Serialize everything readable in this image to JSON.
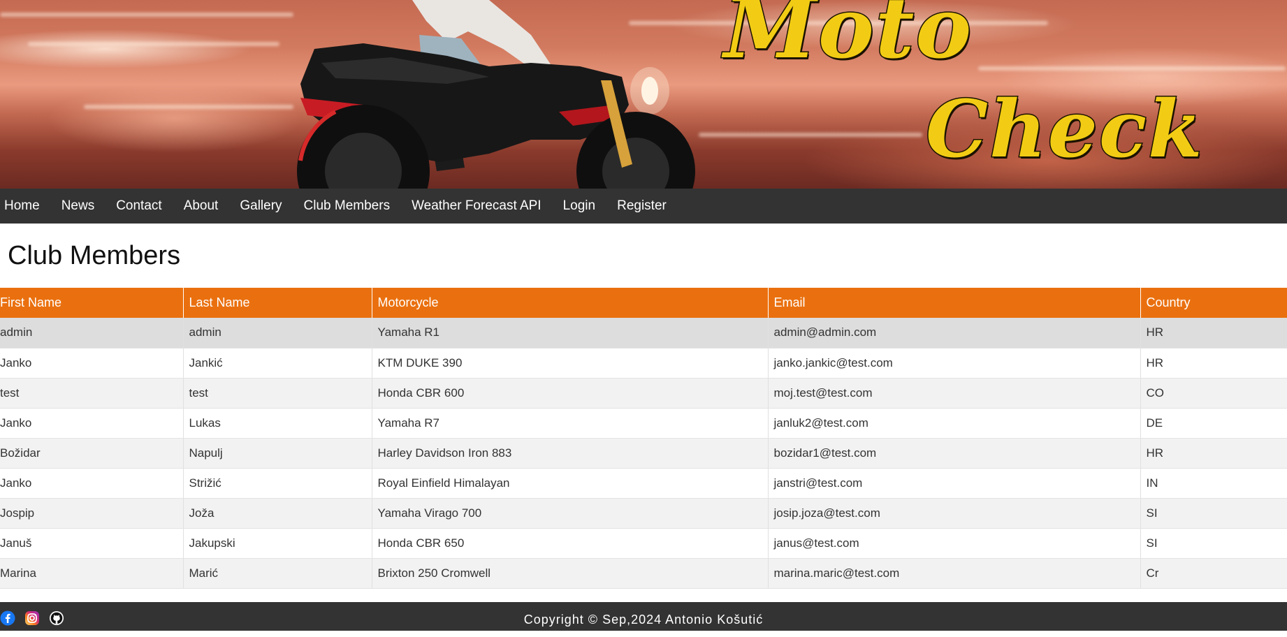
{
  "header": {
    "logo_line1": "Moto",
    "logo_line2": "Check"
  },
  "nav": {
    "items": [
      {
        "label": "Home"
      },
      {
        "label": "News"
      },
      {
        "label": "Contact"
      },
      {
        "label": "About"
      },
      {
        "label": "Gallery"
      },
      {
        "label": "Club Members"
      },
      {
        "label": "Weather Forecast API"
      },
      {
        "label": "Login"
      },
      {
        "label": "Register"
      }
    ]
  },
  "page": {
    "title": "Club Members"
  },
  "table": {
    "headers": [
      "First Name",
      "Last Name",
      "Motorcycle",
      "Email",
      "Country"
    ],
    "rows": [
      [
        "admin",
        "admin",
        "Yamaha R1",
        "admin@admin.com",
        "HR"
      ],
      [
        "Janko",
        "Jankić",
        "KTM DUKE 390",
        "janko.jankic@test.com",
        "HR"
      ],
      [
        "test",
        "test",
        "Honda CBR 600",
        "moj.test@test.com",
        "CO"
      ],
      [
        "Janko",
        "Lukas",
        "Yamaha R7",
        "janluk2@test.com",
        "DE"
      ],
      [
        "Božidar",
        "Napulj",
        "Harley Davidson Iron 883",
        "bozidar1@test.com",
        "HR"
      ],
      [
        "Janko",
        "Strižić",
        "Royal Einfield Himalayan",
        "janstri@test.com",
        "IN"
      ],
      [
        "Jospip",
        "Joža",
        "Yamaha Virago 700",
        "josip.joza@test.com",
        "SI"
      ],
      [
        "Januš",
        "Jakupski",
        "Honda CBR 650",
        "janus@test.com",
        "SI"
      ],
      [
        "Marina",
        "Marić",
        "Brixton 250 Cromwell",
        "marina.maric@test.com",
        "Cr"
      ]
    ]
  },
  "footer": {
    "icons": [
      "facebook-icon",
      "instagram-icon",
      "github-icon"
    ],
    "copyright": "Copyright © Sep,2024 Antonio Košutić"
  },
  "colors": {
    "nav_bg": "#333333",
    "table_header_bg": "#ea700f",
    "logo_yellow": "#f2cc14"
  }
}
